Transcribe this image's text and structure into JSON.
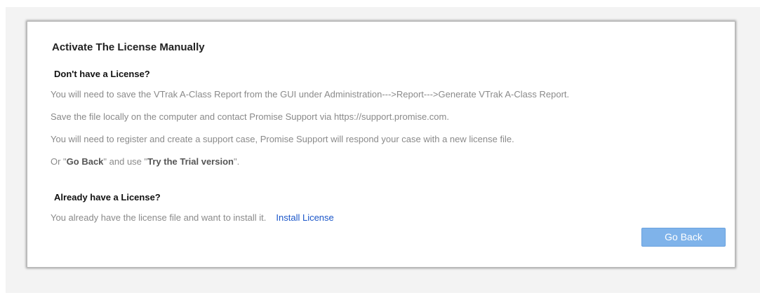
{
  "panel": {
    "title": "Activate The License Manually",
    "no_license": {
      "heading": "Don't have a License?",
      "line1": "You will need to save the VTrak A-Class Report from the GUI under Administration--->Report--->Generate VTrak A-Class Report.",
      "line2": "Save the file locally on the computer and contact Promise Support via https://support.promise.com.",
      "line3": "You will need to register and create a support case, Promise Support will respond your case with a new license file.",
      "line4_prefix": "Or \"",
      "line4_go_back": "Go Back",
      "line4_middle": "\" and use \"",
      "line4_trial": "Try the Trial version",
      "line4_suffix": "\"."
    },
    "has_license": {
      "heading": "Already have a License?",
      "text": "You already have the license file and want to install it.",
      "install_link": "Install License"
    },
    "go_back_button": "Go Back"
  },
  "colors": {
    "link": "#1a56c9",
    "button": "#7fb3ea",
    "body_text": "#8a8a8a"
  }
}
